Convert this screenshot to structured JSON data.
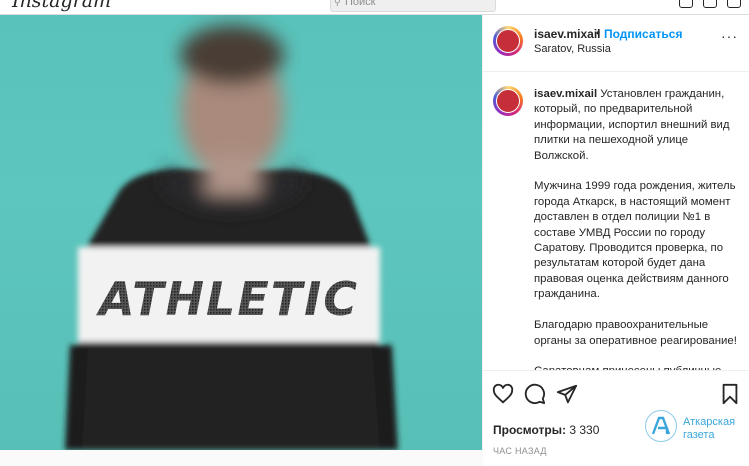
{
  "topbar": {
    "logo": "Instagram",
    "search_placeholder": "Поиск"
  },
  "post": {
    "username": "isaev.mixail",
    "separator": "•",
    "follow_label": "Подписаться",
    "location": "Saratov, Russia",
    "more_label": "···",
    "shirt_text": "ATHLETIC",
    "caption_username": "isaev.mixail",
    "caption_text": " Установлен гражданин, который, по предварительной информации, испортил внешний вид плитки на пешеходной улице Волжской.\n\nМужчина 1999 года рождения, житель города Аткарск, в настоящий момент доставлен в отдел полиции №1 в составе УМВД России по городу Саратову. Проводится проверка, по результатам которой будет дана правовая оценка действиям данного гражданина.\n\nБлагодарю правоохранительные органы за оперативное реагирование!\n\nСаратовцам принесены публичные",
    "views_label": "Просмотры:",
    "views_count": "3 330",
    "time_label": "ЧАС НАЗАД"
  },
  "watermark": {
    "line1": "Аткарская",
    "line2": "газета"
  },
  "colors": {
    "background": "#fafafa",
    "photo_wall": "#5dc6be",
    "link_blue": "#0095f6",
    "text": "#262626",
    "muted": "#8e8e8e",
    "watermark": "#3aa7dc"
  }
}
